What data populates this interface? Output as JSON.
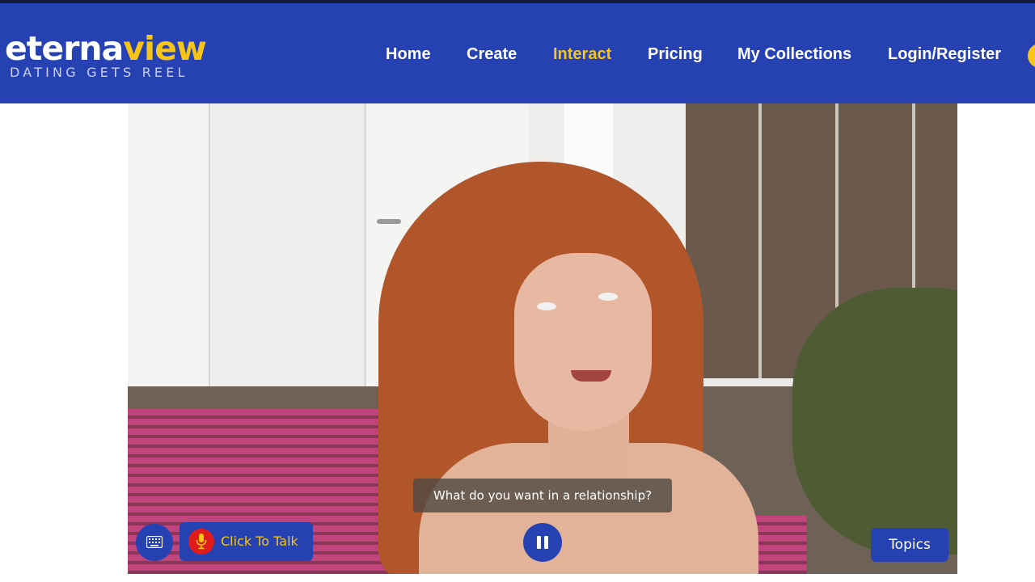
{
  "logo": {
    "part1": "eterna",
    "part2": "view",
    "tagline": "DATING GETS REEL"
  },
  "nav": {
    "home": "Home",
    "create": "Create",
    "interact": "Interact",
    "pricing": "Pricing",
    "collections": "My Collections",
    "login": "Login/Register",
    "active": "Interact"
  },
  "video": {
    "caption": "What do you want in a relationship?",
    "talk_label": "Click To Talk",
    "topics_label": "Topics",
    "keyboard_icon": "keyboard-icon",
    "mic_icon": "microphone-icon",
    "pause_icon": "pause-icon"
  },
  "colors": {
    "brand_blue": "#2541b2",
    "accent_yellow": "#f5c518",
    "mic_red": "#e01b1b"
  }
}
